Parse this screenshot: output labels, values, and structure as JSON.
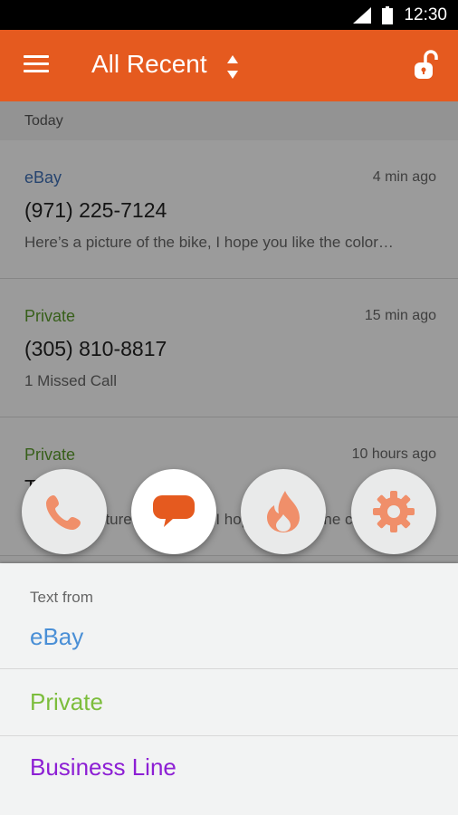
{
  "status_bar": {
    "time": "12:30"
  },
  "app_bar": {
    "title": "All Recent",
    "menu_icon": "menu-icon",
    "sort_icon": "sort-arrows-icon",
    "lock_icon": "unlock-icon"
  },
  "list": {
    "section": "Today",
    "items": [
      {
        "tag": "eBay",
        "tag_color": "#3e6fb4",
        "time": "4 min ago",
        "number": "(971) 225-7124",
        "snippet": "Here’s a picture of the bike, I hope you like the color…"
      },
      {
        "tag": "Private",
        "tag_color": "#5a9a2a",
        "time": "15 min ago",
        "number": "(305) 810-8817",
        "snippet": "1 Missed Call"
      },
      {
        "tag": "Private",
        "tag_color": "#5a9a2a",
        "time": "10 hours ago",
        "number": "T",
        "snippet": "Here’s a picture of the bike, I hope you like the color…"
      }
    ]
  },
  "fabs": [
    {
      "icon": "phone-icon",
      "color": "#f08f6a"
    },
    {
      "icon": "chat-bubble-icon",
      "color": "#e55a1f"
    },
    {
      "icon": "flame-icon",
      "color": "#f08f6a"
    },
    {
      "icon": "gear-icon",
      "color": "#f08f6a"
    }
  ],
  "sheet": {
    "title": "Text from",
    "options": [
      {
        "label": "eBay",
        "color": "#4a8fd6"
      },
      {
        "label": "Private",
        "color": "#7cbd3c"
      },
      {
        "label": "Business Line",
        "color": "#8d1fd4"
      }
    ]
  },
  "colors": {
    "accent": "#e55a1f"
  }
}
